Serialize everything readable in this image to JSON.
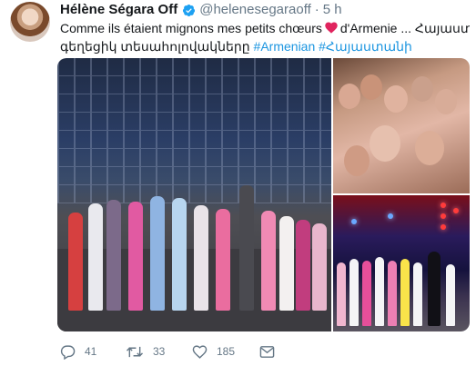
{
  "tweet": {
    "display_name": "Hélène Ségara Off",
    "handle": "@helenesegaraoff",
    "separator": "·",
    "time": "5 h",
    "text_part1": "Comme ils étaient mignons mes petits chœurs",
    "text_part2": "d'Armenie ...",
    "text_armenian": "Հայաստանից",
    "text_line2": "գեղեցիկ տեսահոլովակները",
    "hashtag_1": "#Armenian",
    "hashtag_2": "#Հայաստանի",
    "emoji": "heart-icon"
  },
  "media": {
    "photos": [
      {
        "name": "choir-on-stage-photo"
      },
      {
        "name": "choir-group-selfie-photo"
      },
      {
        "name": "choir-concert-photo"
      }
    ]
  },
  "actions": {
    "reply_count": "41",
    "retweet_count": "33",
    "like_count": "185"
  },
  "colors": {
    "link": "#1b95e0",
    "muted": "#657786",
    "verified": "#1da1f2",
    "heart": "#e0245e"
  }
}
